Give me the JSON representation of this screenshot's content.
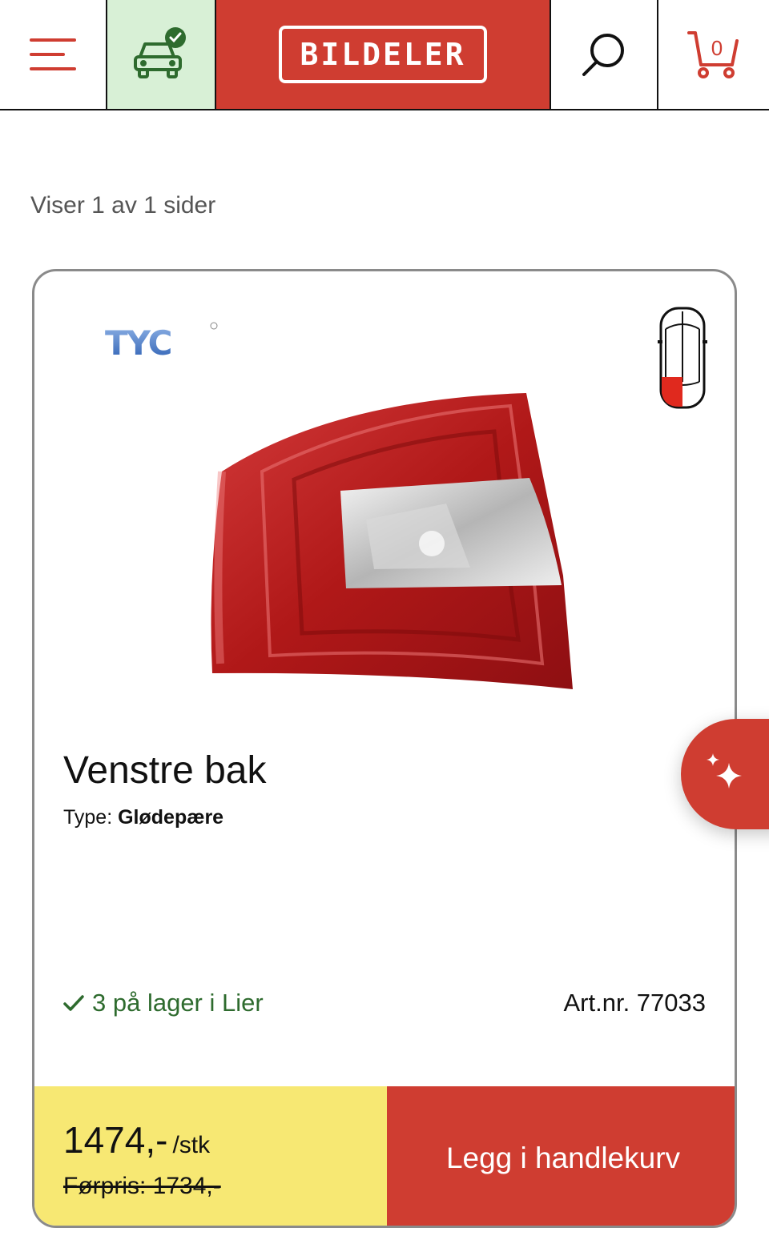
{
  "header": {
    "brand": "BILDELER",
    "cart_count": "0"
  },
  "results": {
    "info": "Viser 1 av 1 sider"
  },
  "product": {
    "brand_logo_text": "TYC",
    "title": "Venstre bak",
    "type_label": "Type:",
    "type_value": "Glødepære",
    "stock": "3 på lager i Lier",
    "artnr": "Art.nr. 77033",
    "price": "1474,-",
    "price_unit": "/stk",
    "old_price": "Førpris: 1734,-",
    "add_to_cart_label": "Legg i handlekurv"
  },
  "colors": {
    "accent": "#cf3d31",
    "car_bg": "#d8f0d6",
    "price_bg": "#f7e873",
    "stock_green": "#2e6b2e"
  },
  "icons": [
    "menu-icon",
    "car-check-icon",
    "search-icon",
    "cart-icon",
    "car-position-icon",
    "sparkle-icon",
    "check-icon"
  ]
}
